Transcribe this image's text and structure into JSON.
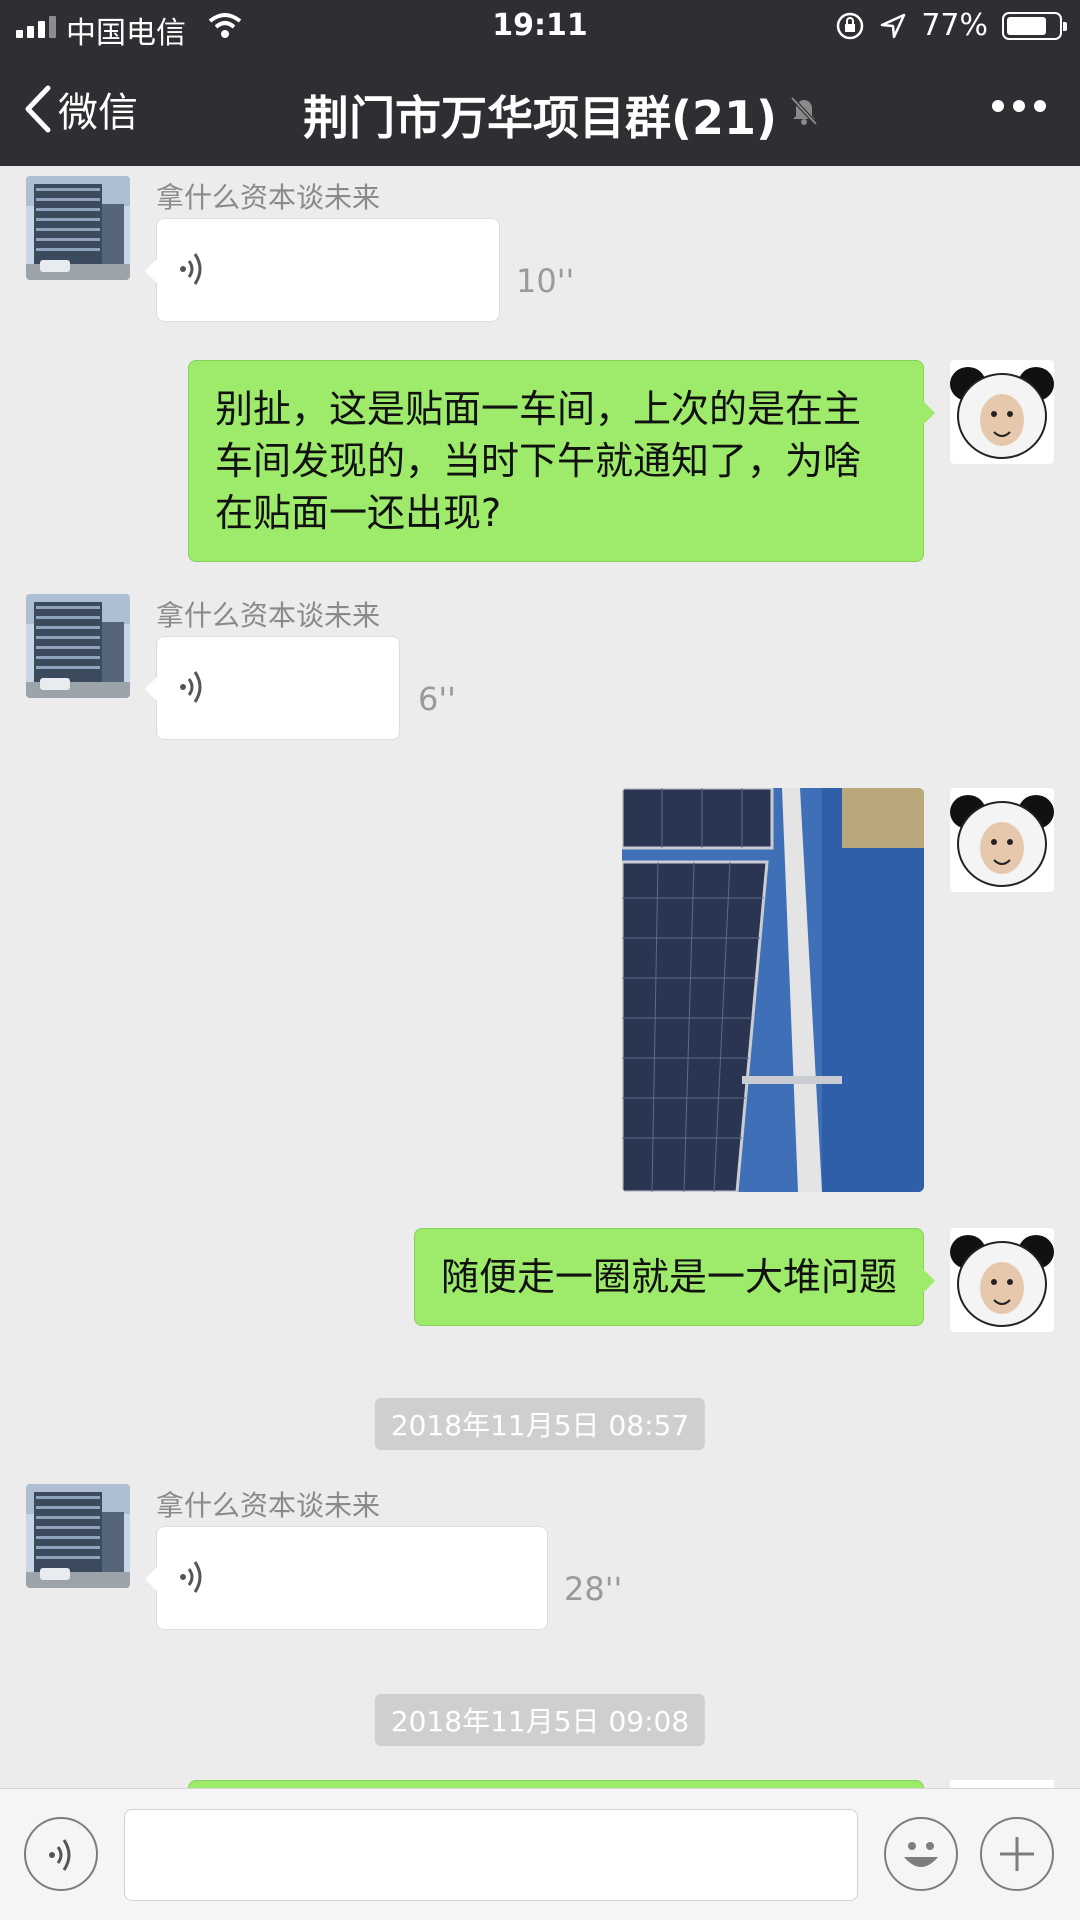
{
  "status": {
    "carrier": "中国电信",
    "time": "19:11",
    "battery": "77%",
    "battery_level": 0.77
  },
  "nav": {
    "back_label": "微信",
    "title": "荆门市万华项目群(21)"
  },
  "messages": {
    "m1": {
      "sender": "拿什么资本谈未来",
      "duration": "10''"
    },
    "m2": {
      "text": "别扯，这是贴面一车间，上次的是在主车间发现的，当时下午就通知了，为啥在贴面一还出现?"
    },
    "m3": {
      "sender": "拿什么资本谈未来",
      "duration": "6''"
    },
    "m5": {
      "text": "随便走一圈就是一大堆问题"
    },
    "ts1": "2018年11月5日 08:57",
    "m6": {
      "sender": "拿什么资本谈未来",
      "duration": "28''"
    },
    "ts2": "2018年11月5日 09:08"
  },
  "colors": {
    "nav_bg": "#2e2e33",
    "chat_bg": "#ececec",
    "outgoing_bubble": "#9eea6a",
    "incoming_bubble": "#ffffff"
  }
}
